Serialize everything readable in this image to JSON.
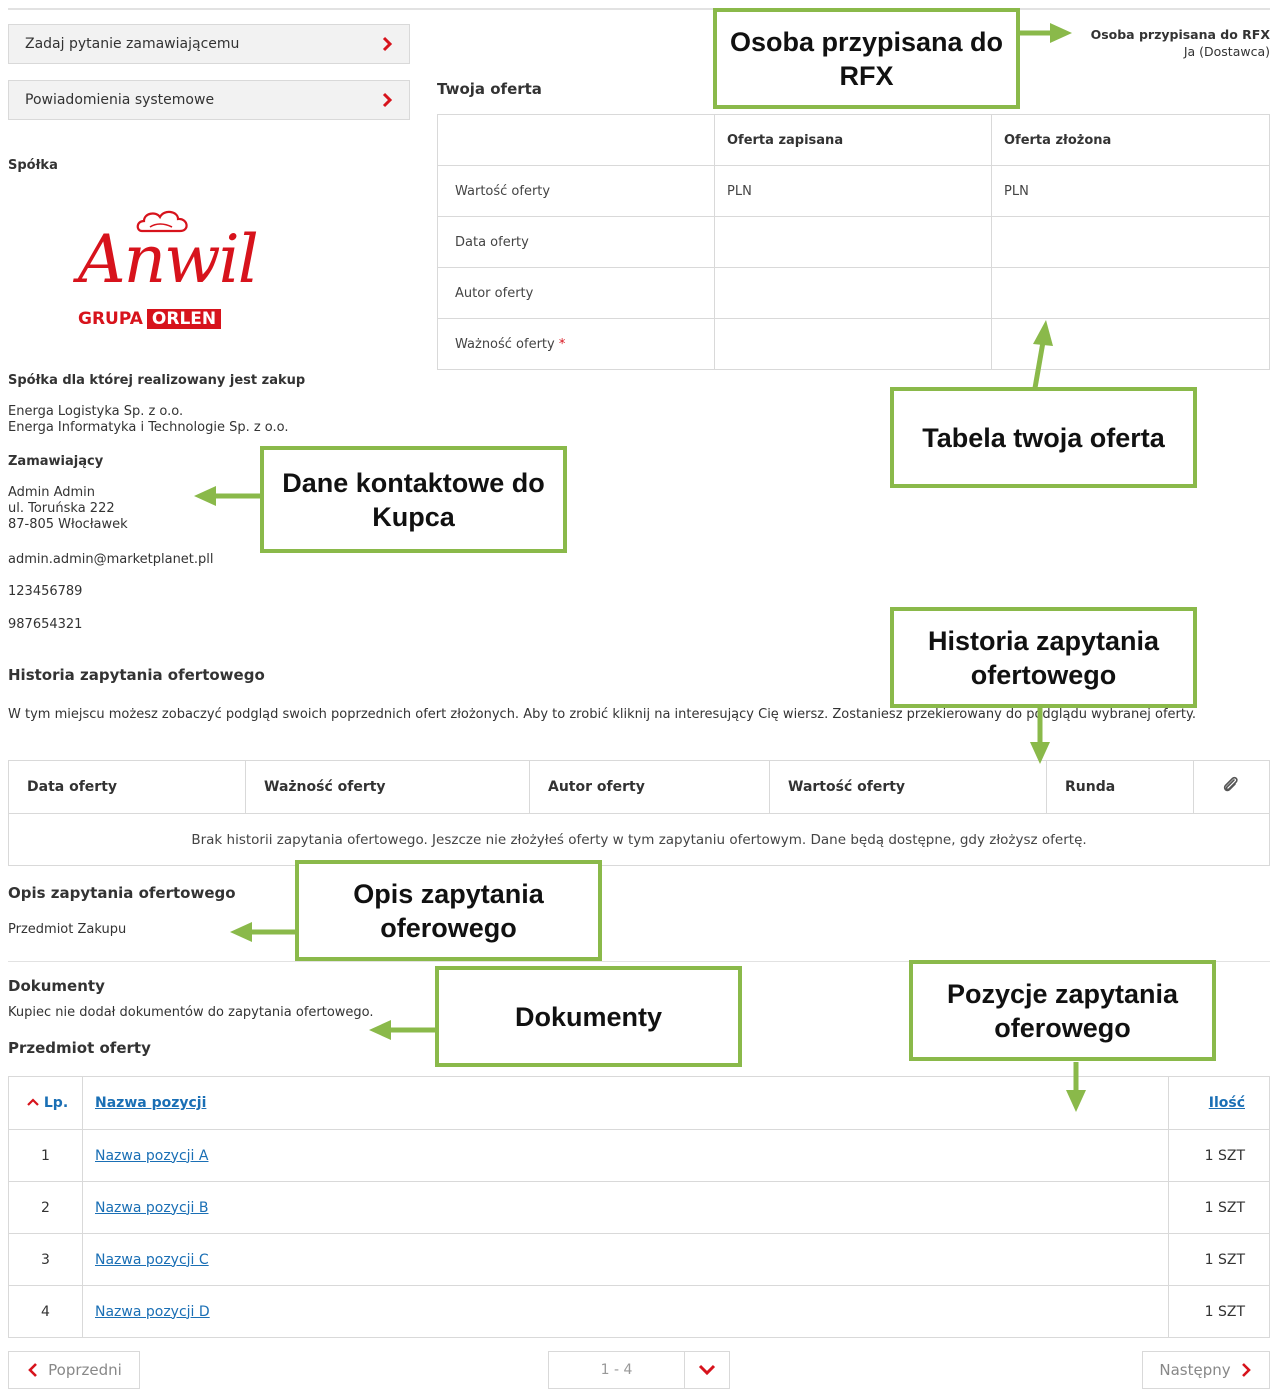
{
  "sidebar": {
    "ask_button": "Zadaj pytanie zamawiającemu",
    "notifications_button": "Powiadomienia systemowe"
  },
  "company": {
    "label": "Spółka",
    "logo_word": "Anwil",
    "logo_grupa": "GRUPA",
    "logo_orlen": "ORLEN",
    "target_label": "Spółka dla której realizowany jest zakup",
    "target_line1": "Energa Logistyka Sp. z o.o.",
    "target_line2": "Energa Informatyka i Technologie Sp. z o.o."
  },
  "buyer": {
    "label": "Zamawiający",
    "name": "Admin Admin",
    "street": "ul. Toruńska 222",
    "city": "87-805 Włocławek",
    "email": "admin.admin@marketplanet.pll",
    "phone1": "123456789",
    "phone2": "987654321"
  },
  "rfx_person": {
    "label": "Osoba przypisana do RFX",
    "value": "Ja (Dostawca)"
  },
  "offer": {
    "title": "Twoja oferta",
    "col_saved": "Oferta zapisana",
    "col_submitted": "Oferta złożona",
    "rows": [
      {
        "label": "Wartość oferty",
        "saved": "PLN",
        "submitted": "PLN"
      },
      {
        "label": "Data oferty",
        "saved": "",
        "submitted": ""
      },
      {
        "label": "Autor oferty",
        "saved": "",
        "submitted": ""
      },
      {
        "label": "Ważność oferty",
        "saved": "",
        "submitted": ""
      }
    ],
    "required_mark": "*"
  },
  "history": {
    "title": "Historia zapytania ofertowego",
    "description": "W tym miejscu możesz zobaczyć podgląd swoich poprzednich ofert złożonych. Aby to zrobić kliknij na interesujący Cię wiersz. Zostaniesz przekierowany do podglądu wybranej oferty.",
    "columns": [
      "Data oferty",
      "Ważność oferty",
      "Autor oferty",
      "Wartość oferty",
      "Runda"
    ],
    "empty": "Brak historii zapytania ofertowego. Jeszcze nie złożyłeś oferty w tym zapytaniu ofertowym. Dane będą dostępne, gdy złożysz ofertę."
  },
  "description": {
    "title": "Opis zapytania ofertowego",
    "text": "Przedmiot Zakupu"
  },
  "documents": {
    "title": "Dokumenty",
    "text": "Kupiec nie dodał dokumentów do zapytania ofertowego."
  },
  "items": {
    "title": "Przedmiot oferty",
    "col_lp": "Lp.",
    "col_name": "Nazwa pozycji",
    "col_qty": "Ilość",
    "rows": [
      {
        "lp": "1",
        "name": "Nazwa pozycji A",
        "qty": "1 SZT"
      },
      {
        "lp": "2",
        "name": "Nazwa pozycji B",
        "qty": "1 SZT"
      },
      {
        "lp": "3",
        "name": "Nazwa pozycji C",
        "qty": "1 SZT"
      },
      {
        "lp": "4",
        "name": "Nazwa pozycji D",
        "qty": "1 SZT"
      }
    ]
  },
  "pager": {
    "prev": "Poprzedni",
    "range": "1 - 4",
    "next": "Następny"
  },
  "callouts": {
    "rfx": "Osoba przypisana do RFX",
    "offer_table": "Tabela twoja oferta",
    "contact": "Dane kontaktowe do Kupca",
    "history": "Historia zapytania ofertowego",
    "description": "Opis zapytania oferowego",
    "documents": "Dokumenty",
    "items": "Pozycje zapytania oferowego"
  },
  "colors": {
    "accent_red": "#d7131c",
    "link_blue": "#1a6fb5",
    "callout_green": "#8ab94a"
  }
}
